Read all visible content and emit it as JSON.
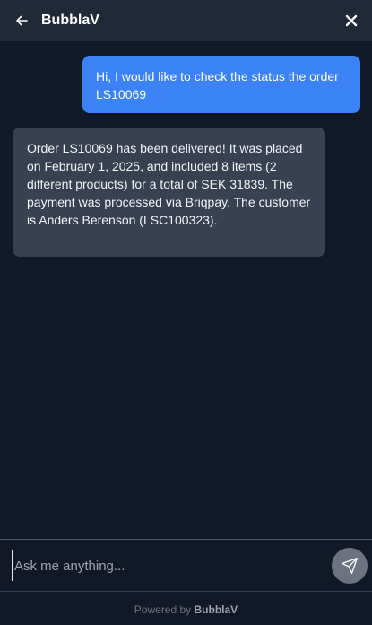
{
  "header": {
    "back_icon": "arrow-left-icon",
    "title": "BubblaV",
    "close_icon": "close-icon"
  },
  "messages": [
    {
      "role": "user",
      "text": "Hi, I would like to check the status the order LS10069"
    },
    {
      "role": "assistant",
      "text": "Order LS10069 has been delivered! It was placed on February 1, 2025, and included 8 items (2 different products) for a total of SEK 31839. The payment was processed via Briqpay. The customer is Anders Berenson (LSC100323)."
    }
  ],
  "composer": {
    "placeholder": "Ask me anything...",
    "value": "",
    "send_icon": "send-icon"
  },
  "footer": {
    "prefix": "Powered by",
    "brand": "BubblaV"
  },
  "colors": {
    "background": "#111827",
    "header": "#1f2937",
    "user_bubble": "#3b82f6",
    "bot_bubble": "#374151",
    "send_button": "#6b7280"
  }
}
